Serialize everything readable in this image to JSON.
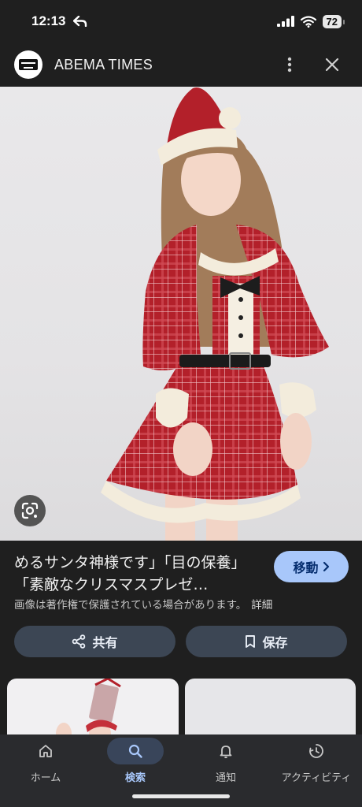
{
  "status_bar": {
    "time": "12:13",
    "battery": "72"
  },
  "header": {
    "source_name": "ABEMA TIMES"
  },
  "result": {
    "title": "めるサンタ神様です」「目の保養」「素敵なクリスマスプレゼ…",
    "move_label": "移動",
    "copyright_notice": "画像は著作権で保護されている場合があります。",
    "details_link": "詳細"
  },
  "actions": {
    "share_label": "共有",
    "save_label": "保存"
  },
  "bottom_nav": {
    "items": [
      {
        "label": "ホーム",
        "icon": "home-icon"
      },
      {
        "label": "検索",
        "icon": "search-icon",
        "active": true
      },
      {
        "label": "通知",
        "icon": "bell-icon"
      },
      {
        "label": "アクティビティ",
        "icon": "activity-icon"
      }
    ]
  },
  "colors": {
    "accent": "#a8c7fa",
    "button": "#3c4654",
    "background": "#1f1f1f"
  }
}
